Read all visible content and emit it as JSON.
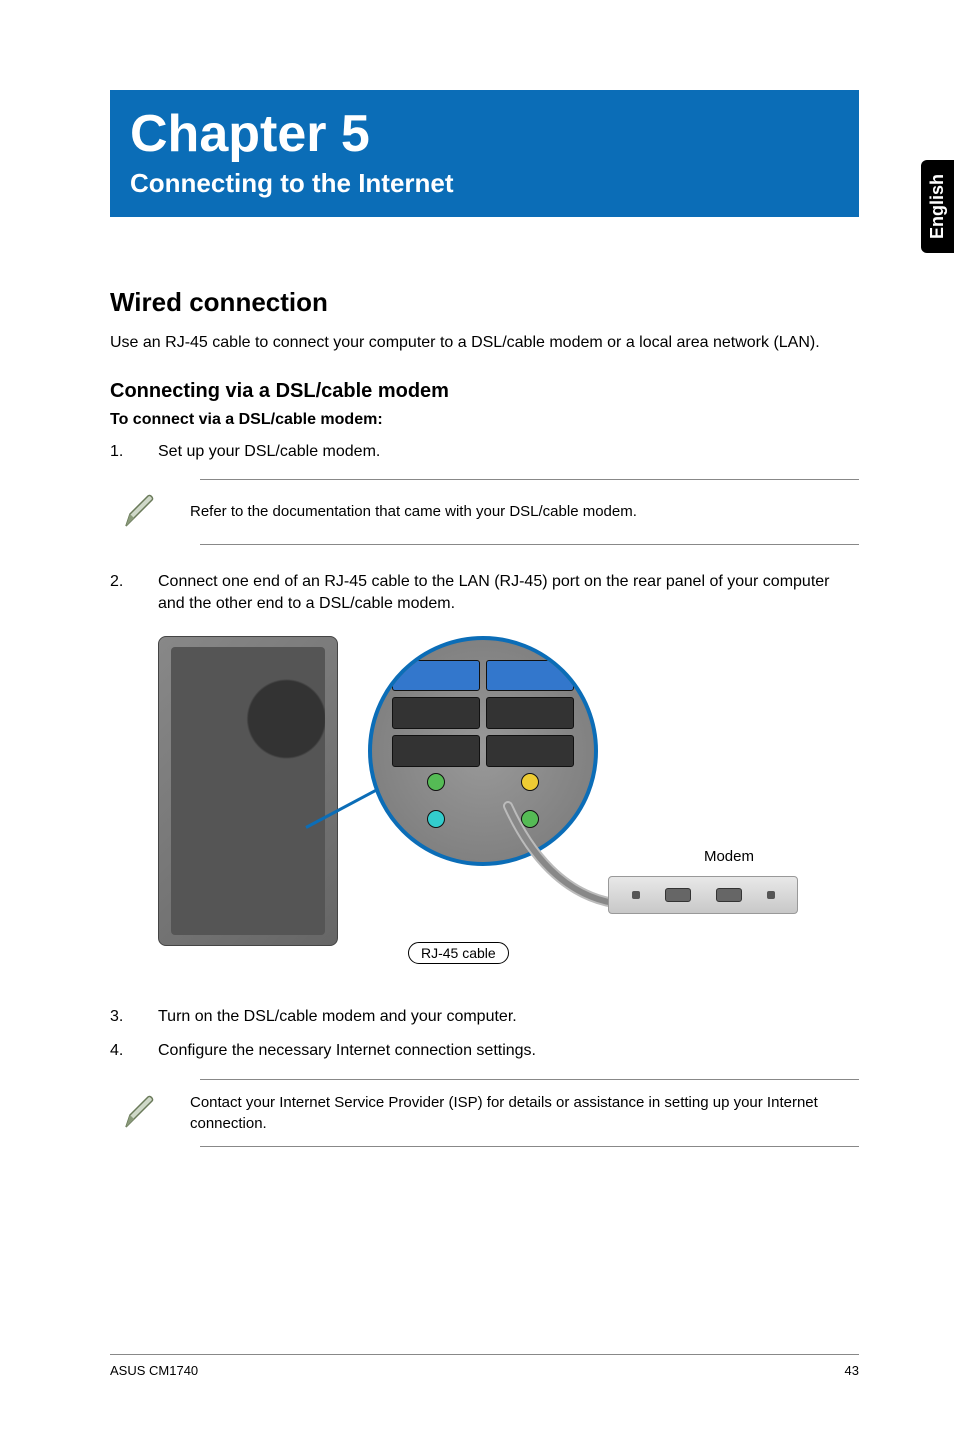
{
  "language_tab": "English",
  "chapter": {
    "title": "Chapter 5",
    "subtitle": "Connecting to the Internet"
  },
  "section": {
    "heading": "Wired connection",
    "intro": "Use an RJ-45 cable to connect your computer to a DSL/cable modem or a local area network (LAN).",
    "subheading": "Connecting via a DSL/cable modem",
    "instruction_label": "To connect via a DSL/cable modem:"
  },
  "steps": {
    "s1_num": "1.",
    "s1_text": "Set up your DSL/cable modem.",
    "s2_num": "2.",
    "s2_text": "Connect one end of an RJ-45 cable to the LAN (RJ-45) port on the rear panel of your computer and the other end to a DSL/cable modem.",
    "s3_num": "3.",
    "s3_text": "Turn on the DSL/cable modem and your computer.",
    "s4_num": "4.",
    "s4_text": "Configure the necessary Internet connection settings."
  },
  "notes": {
    "n1": "Refer to the documentation that came with your DSL/cable modem.",
    "n2": "Contact your Internet Service Provider (ISP) for details or assistance in setting up your Internet connection."
  },
  "diagram": {
    "modem_label": "Modem",
    "cable_label": "RJ-45 cable"
  },
  "footer": {
    "product": "ASUS CM1740",
    "page": "43"
  }
}
